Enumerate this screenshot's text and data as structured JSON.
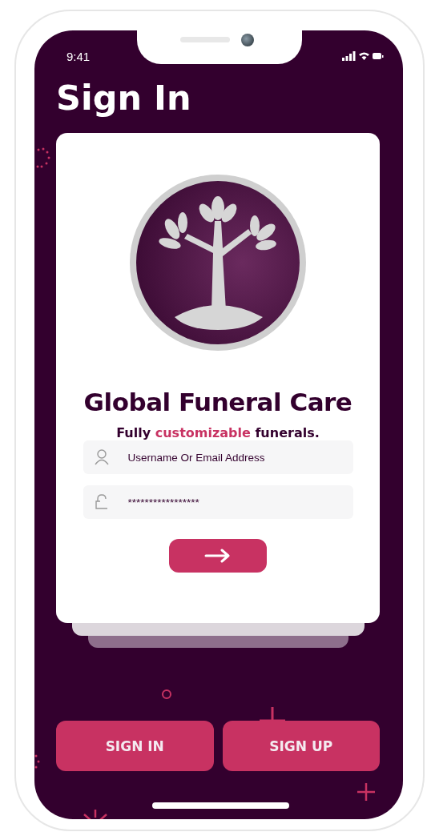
{
  "status_bar": {
    "time": "9:41"
  },
  "title": "Sign In",
  "brand": {
    "name": "Global Funeral Care",
    "tagline": [
      {
        "text": "Fully ",
        "accent": false
      },
      {
        "text": "customizable",
        "accent": true
      },
      {
        "text": " funerals.",
        "accent": false
      }
    ]
  },
  "fields": [
    {
      "kind": "username",
      "placeholder": "Username Or Email Address"
    },
    {
      "kind": "password",
      "value": "*****************"
    }
  ],
  "buttons": [
    {
      "label": "SIGN IN"
    },
    {
      "label": "SIGN UP"
    }
  ]
}
